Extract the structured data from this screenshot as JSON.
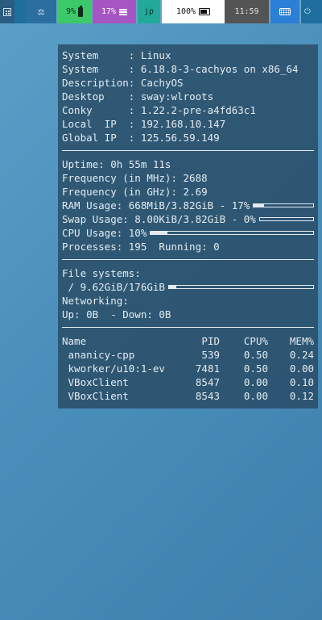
{
  "topbar": {
    "battery": "9%",
    "cpu": "17%",
    "language": "jp",
    "volume": "100%",
    "clock": "11:59"
  },
  "conky": {
    "info": [
      {
        "label": "System     ",
        "value": "Linux"
      },
      {
        "label": "System     ",
        "value": "6.18.8-3-cachyos on x86_64"
      },
      {
        "label": "Description",
        "value": "CachyOS"
      },
      {
        "label": "Desktop    ",
        "value": "sway:wlroots"
      },
      {
        "label": "Conky      ",
        "value": "1.22.2-pre-a4fd63c1"
      },
      {
        "label": "Local  IP  ",
        "value": "192.168.10.147"
      },
      {
        "label": "Global IP  ",
        "value": "125.56.59.149"
      }
    ],
    "uptime": "Uptime: 0h 55m 11s",
    "freq_mhz": "Frequency (in MHz): 2688",
    "freq_ghz": "Frequency (in GHz): 2.69",
    "ram_usage": "RAM Usage: 668MiB/3.82GiB - 17%",
    "ram_fraction": 0.17,
    "swap_usage": "Swap Usage: 8.00KiB/3.82GiB - 0%",
    "swap_fraction": 0.0,
    "cpu_usage": "CPU Usage: 10%",
    "cpu_fraction": 0.1,
    "processes": "Processes: 195  Running: 0",
    "fs_title": "File systems:",
    "fs_root": " / 9.62GiB/176GiB",
    "fs_fraction": 0.05,
    "net_title": "Networking:",
    "net_line": "Up: 0B  - Down: 0B",
    "proc_headers": [
      "Name",
      "PID",
      "CPU%",
      "MEM%"
    ],
    "proc_rows": [
      {
        "name": " ananicy-cpp",
        "pid": "539",
        "cpu": "0.50",
        "mem": "0.24"
      },
      {
        "name": " kworker/u10:1-ev",
        "pid": "7481",
        "cpu": "0.50",
        "mem": "0.00"
      },
      {
        "name": " VBoxClient",
        "pid": "8547",
        "cpu": "0.00",
        "mem": "0.10"
      },
      {
        "name": " VBoxClient",
        "pid": "8543",
        "cpu": "0.00",
        "mem": "0.12"
      }
    ]
  }
}
